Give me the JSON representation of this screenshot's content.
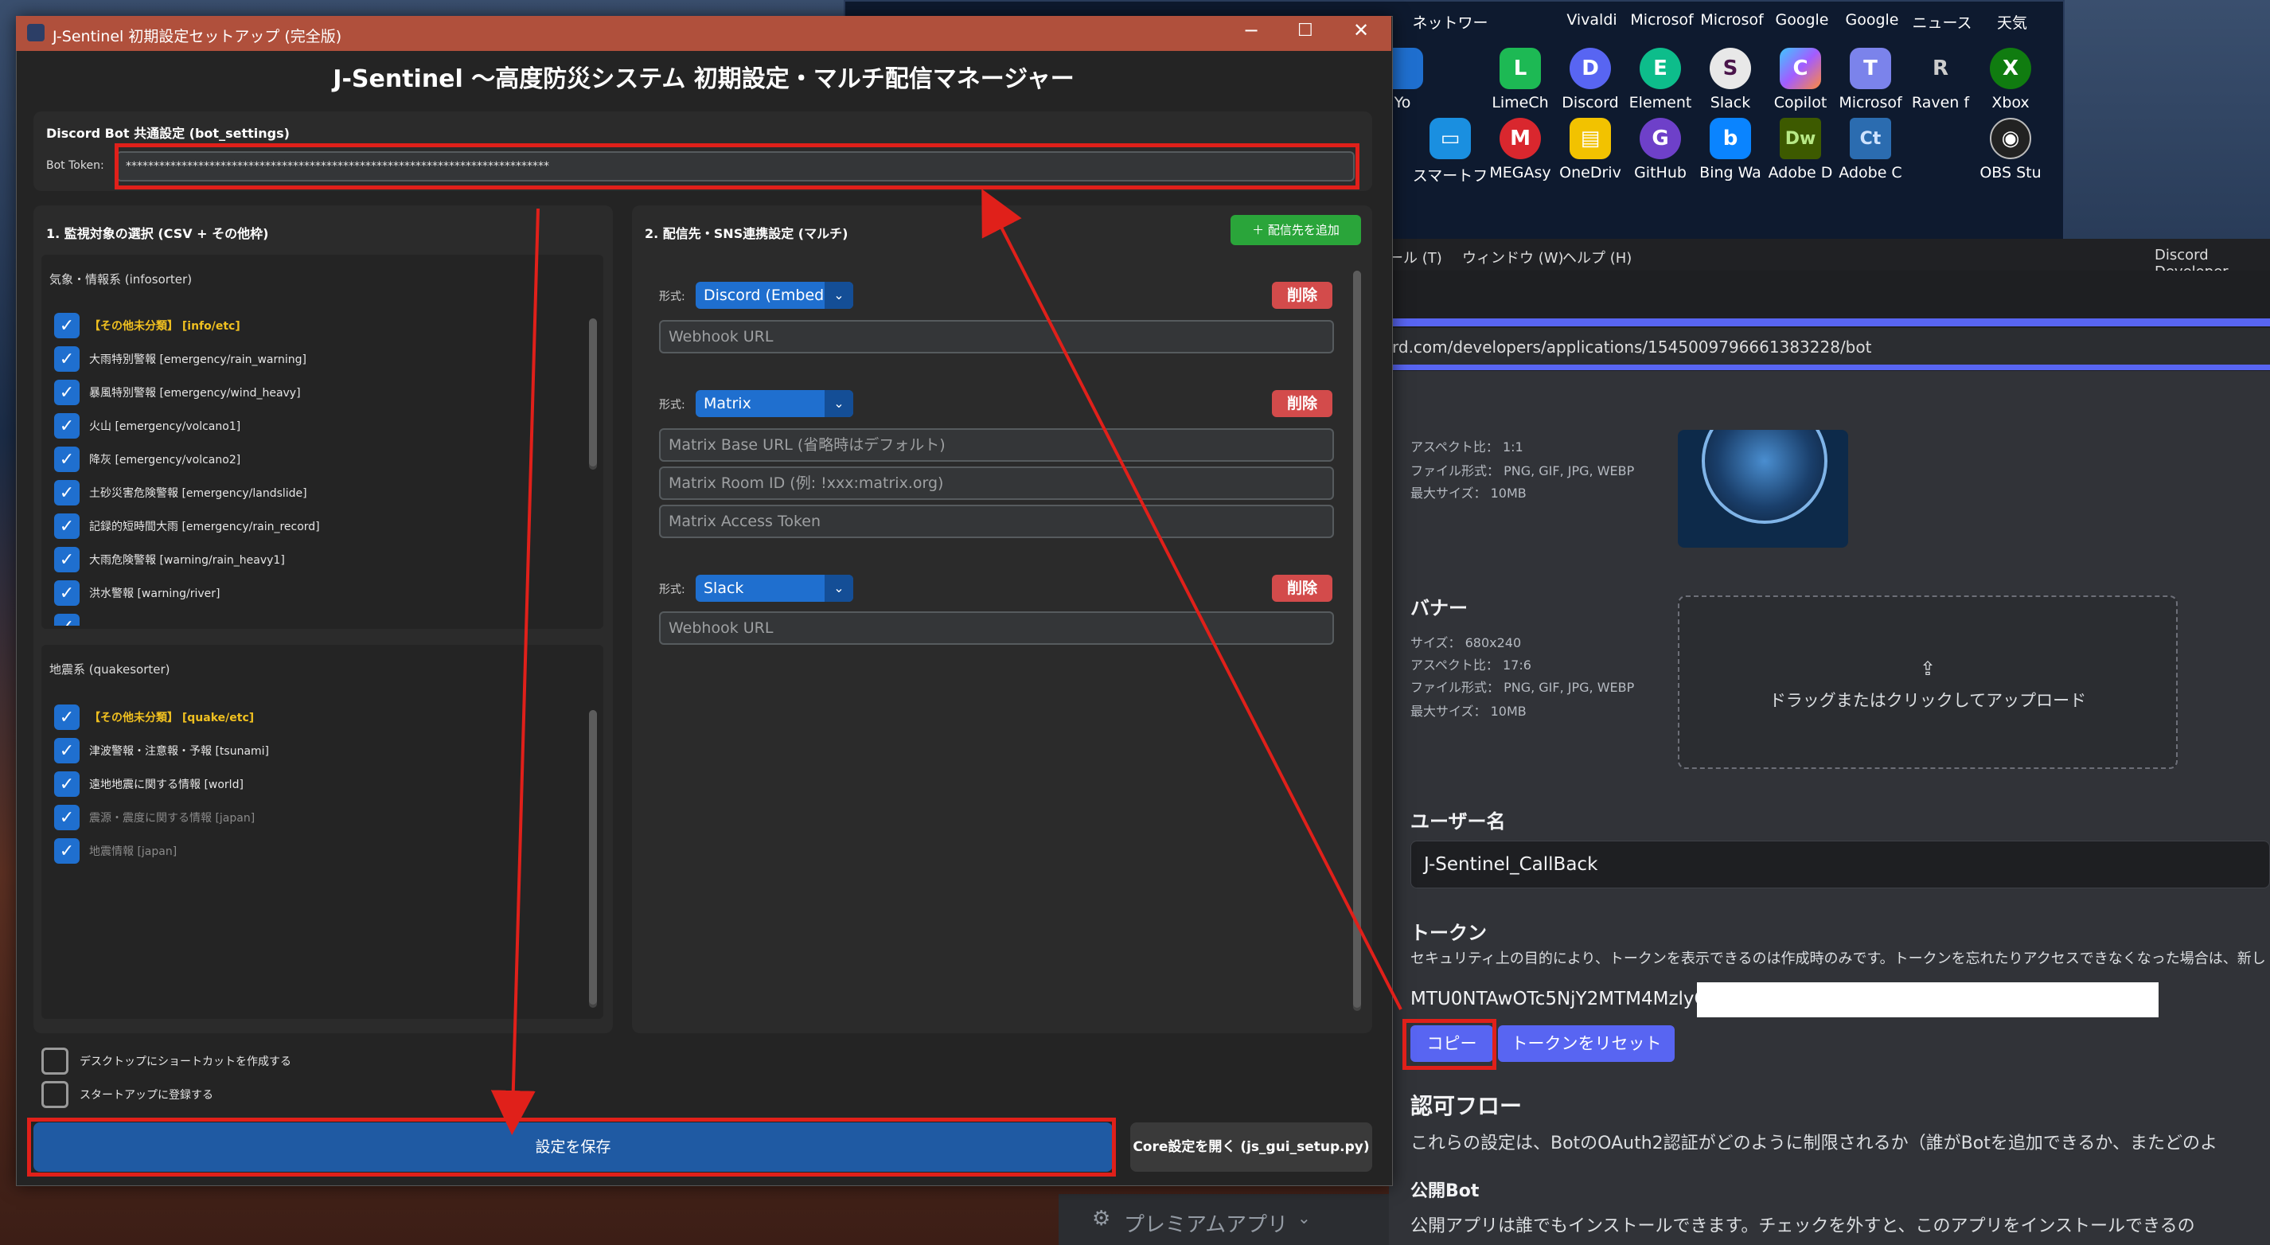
{
  "desktop": {
    "icons_row1": [
      "ネットワー",
      "Vivaldi",
      "Microsof",
      "Microsof",
      "Google",
      "Google",
      "ニュース",
      "天気"
    ],
    "icons_row2": [
      {
        "label": "Yo",
        "color": "#1f6fcf"
      },
      {
        "label": "LimeCh",
        "color": "#1db954",
        "glyph": "L"
      },
      {
        "label": "Discord",
        "color": "#5865f2",
        "glyph": "D"
      },
      {
        "label": "Element",
        "color": "#0dbd8b",
        "glyph": "E"
      },
      {
        "label": "Slack",
        "color": "#e8e8e8",
        "glyph": "S"
      },
      {
        "label": "Copilot",
        "color": "#7a5cff",
        "glyph": "C"
      },
      {
        "label": "Microsof",
        "color": "#7b83eb",
        "glyph": "T"
      },
      {
        "label": "Raven f",
        "color": "#555",
        "glyph": "R"
      },
      {
        "label": "Xbox",
        "color": "#107c10",
        "glyph": "X"
      }
    ],
    "icons_row3": [
      {
        "label": "スマートフ",
        "color": "#1a8fe0",
        "glyph": "▭"
      },
      {
        "label": "MEGAsy",
        "color": "#d9272e",
        "glyph": "M"
      },
      {
        "label": "OneDriv",
        "color": "#f2c200",
        "glyph": "▤"
      },
      {
        "label": "GitHub",
        "color": "#6e40c9",
        "glyph": "G"
      },
      {
        "label": "Bing Wa",
        "color": "#0a84ff",
        "glyph": "b"
      },
      {
        "label": "Adobe D",
        "color": "#3d5a00",
        "glyph": "Dw"
      },
      {
        "label": "Adobe C",
        "color": "#2b6cb0",
        "glyph": "Ct"
      },
      {
        "label": "OBS Stu",
        "color": "#222",
        "glyph": "◉"
      }
    ]
  },
  "browser": {
    "menu": [
      "ール (T)",
      "ウィンドウ (W)",
      "ヘルプ (H)"
    ],
    "app_title": "Discord Developer",
    "url": "rd.com/developers/applications/1545009796661383228/bot",
    "avatar_info": [
      "アスペクト比： 1:1",
      "ファイル形式： PNG, GIF, JPG, WEBP",
      "最大サイズ： 10MB"
    ],
    "banner_title": "バナー",
    "banner_info": [
      "サイズ： 680x240",
      "アスペクト比： 17:6",
      "ファイル形式： PNG, GIF, JPG, WEBP",
      "最大サイズ： 10MB"
    ],
    "upload_text": "ドラッグまたはクリックしてアップロード",
    "username_label": "ユーザー名",
    "username_value": "J-Sentinel_CallBack",
    "token_label": "トークン",
    "token_note": "セキュリティ上の目的により、トークンを表示できるのは作成時のみです。トークンを忘れたりアクセスできなくなった場合は、新し",
    "token_value": "MTU0NTAwOTc5NjY2MTM4MzlyOA",
    "copy_button": "コピー",
    "reset_button": "トークンをリセット",
    "auth_flow_title": "認可フロー",
    "auth_flow_text": "これらの設定は、BotのOAuth2認証がどのように制限されるか（誰がBotを追加できるか、またどのよ",
    "public_bot_title": "公開Bot",
    "public_bot_text": "公開アプリは誰でもインストールできます。チェックを外すと、このアプリをインストールできるの",
    "sidebar_premium": "プレミアムアプリ"
  },
  "setup": {
    "window_title": "J-Sentinel 初期設定セットアップ (完全版)",
    "main_title": "J-Sentinel 〜高度防災システム 初期設定・マルチ配信マネージャー",
    "bot_settings_title": "Discord Bot 共通設定 (bot_settings)",
    "bot_token_label": "Bot Token:",
    "bot_token_value": "****************************************************************************",
    "monitor_title": "1. 監視対象の選択 (CSV + その他枠)",
    "weather_group": "気象・情報系 (infosorter)",
    "weather_items": [
      {
        "label": "【その他未分類】 [info/etc]",
        "style": "gold"
      },
      {
        "label": "大雨特別警報 [emergency/rain_warning]",
        "style": "normal"
      },
      {
        "label": "暴風特別警報 [emergency/wind_heavy]",
        "style": "normal"
      },
      {
        "label": "火山 [emergency/volcano1]",
        "style": "normal"
      },
      {
        "label": "降灰 [emergency/volcano2]",
        "style": "normal"
      },
      {
        "label": "土砂災害危険警報 [emergency/landslide]",
        "style": "normal"
      },
      {
        "label": "記録的短時間大雨 [emergency/rain_record]",
        "style": "normal"
      },
      {
        "label": "大雨危険警報 [warning/rain_heavy1]",
        "style": "normal"
      },
      {
        "label": "洪水警報 [warning/river]",
        "style": "normal"
      }
    ],
    "quake_group": "地震系 (quakesorter)",
    "quake_items": [
      {
        "label": "【その他未分類】 [quake/etc]",
        "style": "gold"
      },
      {
        "label": "津波警報・注意報・予報 [tsunami]",
        "style": "normal"
      },
      {
        "label": "遠地地震に関する情報 [world]",
        "style": "normal"
      },
      {
        "label": "震源・震度に関する情報 [japan]",
        "style": "dim"
      },
      {
        "label": "地震情報 [japan]",
        "style": "dim"
      }
    ],
    "delivery_title": "2. 配信先・SNS連携設定 (マルチ)",
    "add_delivery_button": "＋ 配信先を追加",
    "format_label": "形式:",
    "delete_label": "削除",
    "destinations": [
      {
        "type": "Discord (Embed)",
        "fields": [
          "Webhook URL"
        ]
      },
      {
        "type": "Matrix",
        "fields": [
          "Matrix Base URL (省略時はデフォルト)",
          "Matrix Room ID (例: !xxx:matrix.org)",
          "Matrix Access Token"
        ]
      },
      {
        "type": "Slack",
        "fields": [
          "Webhook URL"
        ]
      }
    ],
    "shortcut_label": "デスクトップにショートカットを作成する",
    "startup_label": "スタートアップに登録する",
    "save_button": "設定を保存",
    "core_button": "Core設定を開く (js_gui_setup.py)"
  },
  "colors": {
    "accent_blue": "#1f6fcf",
    "delete_red": "#d34b4b",
    "add_green": "#2aa53a",
    "annotation_red": "#e0201a",
    "discord_blurple": "#5865f2",
    "title_bar": "#b0503c"
  }
}
